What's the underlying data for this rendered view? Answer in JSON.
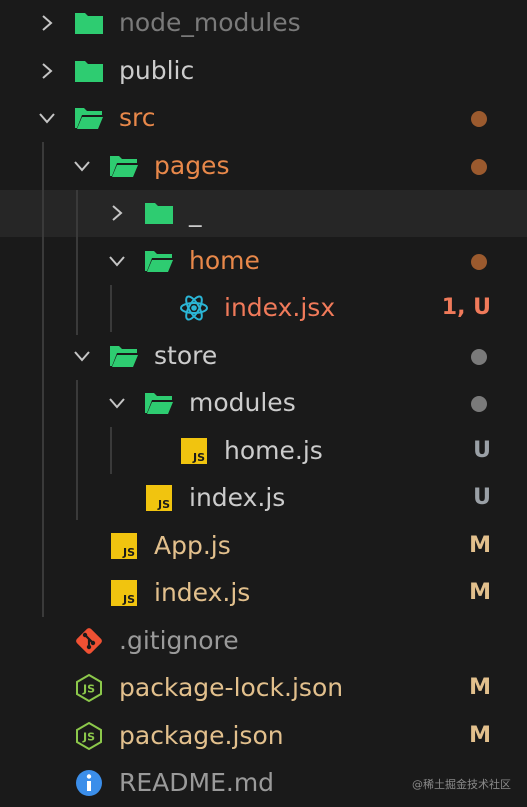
{
  "colors": {
    "background": "#1a1a1a",
    "selected_row": "#262626",
    "folder_icon": "#2ecc71",
    "text_default": "#cccccc",
    "text_dimmed": "#7a7a7a",
    "text_modified": "#e2c08d",
    "text_untracked": "#e8884a",
    "text_error": "#f07a5a",
    "badge_untracked": "#9aa0a6",
    "dot_modified": "#9b5a2e",
    "dot_gray": "#7a7a7a"
  },
  "tree": [
    {
      "label": "node_modules",
      "type": "folder",
      "state": "collapsed",
      "depth": 0,
      "label_color": "#7a7a7a"
    },
    {
      "label": "public",
      "type": "folder",
      "state": "collapsed",
      "depth": 0,
      "label_color": "#cccccc"
    },
    {
      "label": "src",
      "type": "folder",
      "state": "expanded",
      "depth": 0,
      "label_color": "#e8884a",
      "status": "dot",
      "dot_color": "#9b5a2e"
    },
    {
      "label": "pages",
      "type": "folder",
      "state": "expanded",
      "depth": 1,
      "label_color": "#e8884a",
      "status": "dot",
      "dot_color": "#9b5a2e"
    },
    {
      "label": "_",
      "type": "folder",
      "state": "collapsed",
      "depth": 2,
      "label_color": "#cccccc",
      "selected": true
    },
    {
      "label": "home",
      "type": "folder",
      "state": "expanded",
      "depth": 2,
      "label_color": "#e8884a",
      "status": "dot",
      "dot_color": "#9b5a2e"
    },
    {
      "label": "index.jsx",
      "type": "react",
      "depth": 3,
      "label_color": "#f07a5a",
      "badge": "1, U",
      "badge_color": "#f07a5a"
    },
    {
      "label": "store",
      "type": "folder",
      "state": "expanded",
      "depth": 1,
      "label_color": "#cccccc",
      "status": "dot",
      "dot_color": "#7a7a7a"
    },
    {
      "label": "modules",
      "type": "folder",
      "state": "expanded",
      "depth": 2,
      "label_color": "#cccccc",
      "status": "dot",
      "dot_color": "#7a7a7a"
    },
    {
      "label": "home.js",
      "type": "js",
      "depth": 3,
      "label_color": "#cccccc",
      "badge": "U",
      "badge_color": "#9aa0a6"
    },
    {
      "label": "index.js",
      "type": "js",
      "depth": 2,
      "label_color": "#cccccc",
      "badge": "U",
      "badge_color": "#9aa0a6"
    },
    {
      "label": "App.js",
      "type": "js",
      "depth": 1,
      "label_color": "#e2c08d",
      "badge": "M",
      "badge_color": "#e2c08d"
    },
    {
      "label": "index.js",
      "type": "js",
      "depth": 1,
      "label_color": "#e2c08d",
      "badge": "M",
      "badge_color": "#e2c08d"
    },
    {
      "label": ".gitignore",
      "type": "git",
      "depth": 0,
      "label_color": "#9a9a9a"
    },
    {
      "label": "package-lock.json",
      "type": "node",
      "depth": 0,
      "label_color": "#e2c08d",
      "badge": "M",
      "badge_color": "#e2c08d"
    },
    {
      "label": "package.json",
      "type": "node",
      "depth": 0,
      "label_color": "#e2c08d",
      "badge": "M",
      "badge_color": "#e2c08d"
    },
    {
      "label": "README.md",
      "type": "info",
      "depth": 0,
      "label_color": "#9a9a9a"
    }
  ],
  "watermark": "@稀土掘金技术社区"
}
